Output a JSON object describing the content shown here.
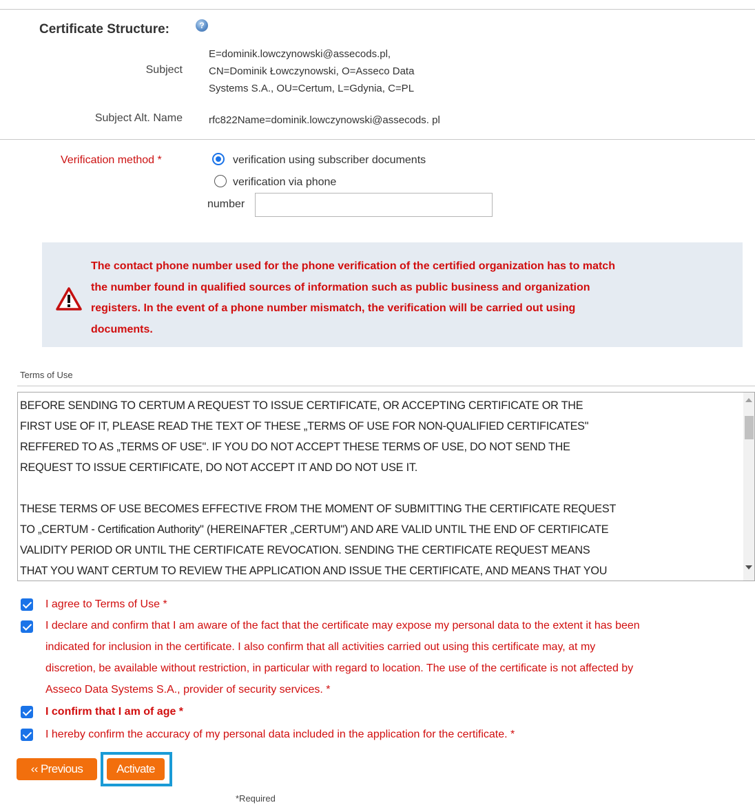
{
  "certificate": {
    "section_title": "Certificate Structure:",
    "help_icon": "help-icon",
    "subject_label": "Subject",
    "subject_lines": [
      "E=dominik.lowczynowski@assecods.pl,",
      "CN=Dominik Łowczynowski, O=Asseco Data",
      "Systems S.A., OU=Certum, L=Gdynia, C=PL"
    ],
    "alt_name_label": "Subject Alt. Name",
    "alt_name_value": "rfc822Name=dominik.lowczynowski@assecods. pl"
  },
  "verification": {
    "label": "Verification method *",
    "options": [
      {
        "label": "verification using subscriber documents",
        "selected": true
      },
      {
        "label": "verification via phone",
        "selected": false
      }
    ],
    "number_label": "number",
    "number_value": ""
  },
  "warning": {
    "icon": "warning-triangle-icon",
    "lines": [
      "The contact phone number used for the phone verification of the certified organization has to match",
      "the number found in qualified sources of information such as public business and organization",
      "registers. In the event of a phone number mismatch, the verification will be carried out using",
      "documents."
    ]
  },
  "terms": {
    "label": "Terms of Use",
    "paragraph1_lines": [
      "BEFORE SENDING TO CERTUM A REQUEST TO ISSUE CERTIFICATE, OR ACCEPTING CERTIFICATE OR THE",
      "FIRST USE OF IT, PLEASE READ THE TEXT OF THESE „TERMS OF USE FOR NON-QUALIFIED CERTIFICATES\"",
      "REFFERED TO AS „TERMS OF USE\". IF YOU DO NOT ACCEPT THESE TERMS OF USE, DO NOT SEND THE",
      "REQUEST TO ISSUE CERTIFICATE, DO NOT ACCEPT IT AND DO NOT USE IT."
    ],
    "paragraph2_lines": [
      "THESE TERMS OF USE BECOMES EFFECTIVE FROM THE MOMENT OF SUBMITTING THE CERTIFICATE REQUEST",
      "TO „CERTUM - Certification Authority\" (HEREINAFTER „CERTUM\") AND ARE VALID UNTIL THE END OF CERTIFICATE",
      "VALIDITY PERIOD OR UNTIL THE CERTIFICATE REVOCATION. SENDING THE CERTIFICATE REQUEST MEANS",
      "THAT YOU WANT CERTUM TO REVIEW THE APPLICATION AND ISSUE THE CERTIFICATE, AND MEANS THAT YOU"
    ]
  },
  "consents": [
    {
      "lines": [
        "I agree to Terms of Use *"
      ],
      "checked": true,
      "bold": false
    },
    {
      "lines": [
        "I declare and confirm that I am aware of the fact that the certificate may expose my personal data to the extent it has been",
        "indicated for inclusion in the certificate. I also confirm that all activities carried out using this certificate may, at my",
        "discretion, be available without restriction, in particular with regard to location. The use of the certificate is not affected by",
        "Asseco Data Systems S.A., provider of security services. *"
      ],
      "checked": true,
      "bold": false
    },
    {
      "lines": [
        "I confirm that I am of age *"
      ],
      "checked": true,
      "bold": true
    },
    {
      "lines": [
        "I hereby confirm the accuracy of my personal data included in the application for the certificate. *"
      ],
      "checked": true,
      "bold": false
    }
  ],
  "buttons": {
    "previous": "‹‹ Previous",
    "activate": "Activate"
  },
  "required_note": "*Required",
  "colors": {
    "accent_orange": "#f26f0d",
    "required_red": "#d10e0e",
    "checkbox_blue": "#1a73e8",
    "highlight_blue": "#1a9bd6",
    "warning_bg": "#e5ebf2"
  }
}
